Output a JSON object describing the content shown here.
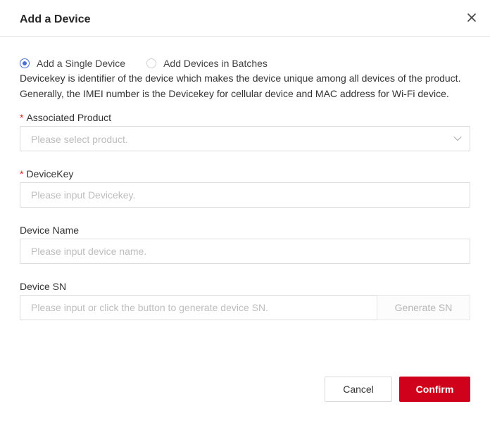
{
  "dialog": {
    "title": "Add a Device",
    "close_icon": "close-icon"
  },
  "mode": {
    "options": [
      {
        "label": "Add a Single Device",
        "checked": true
      },
      {
        "label": "Add Devices in Batches",
        "checked": false
      }
    ]
  },
  "description": {
    "line1": "Devicekey is identifier of the device which makes the device unique among all devices of the product.",
    "line2": "Generally, the IMEI number is the Devicekey for cellular device and MAC address for Wi-Fi device."
  },
  "fields": {
    "product": {
      "required_mark": "*",
      "label": "Associated Product",
      "placeholder": "Please select product.",
      "icon": "chevron-down-icon"
    },
    "devicekey": {
      "required_mark": "*",
      "label": "DeviceKey",
      "placeholder": "Please input Devicekey."
    },
    "device_name": {
      "label": "Device Name",
      "placeholder": "Please input device name."
    },
    "device_sn": {
      "label": "Device SN",
      "placeholder": "Please input or click the button to generate device SN.",
      "generate_label": "Generate SN"
    }
  },
  "footer": {
    "cancel_label": "Cancel",
    "confirm_label": "Confirm"
  },
  "colors": {
    "accent": "#4a6fd6",
    "primary_button": "#d0021b",
    "required": "#e02020"
  }
}
